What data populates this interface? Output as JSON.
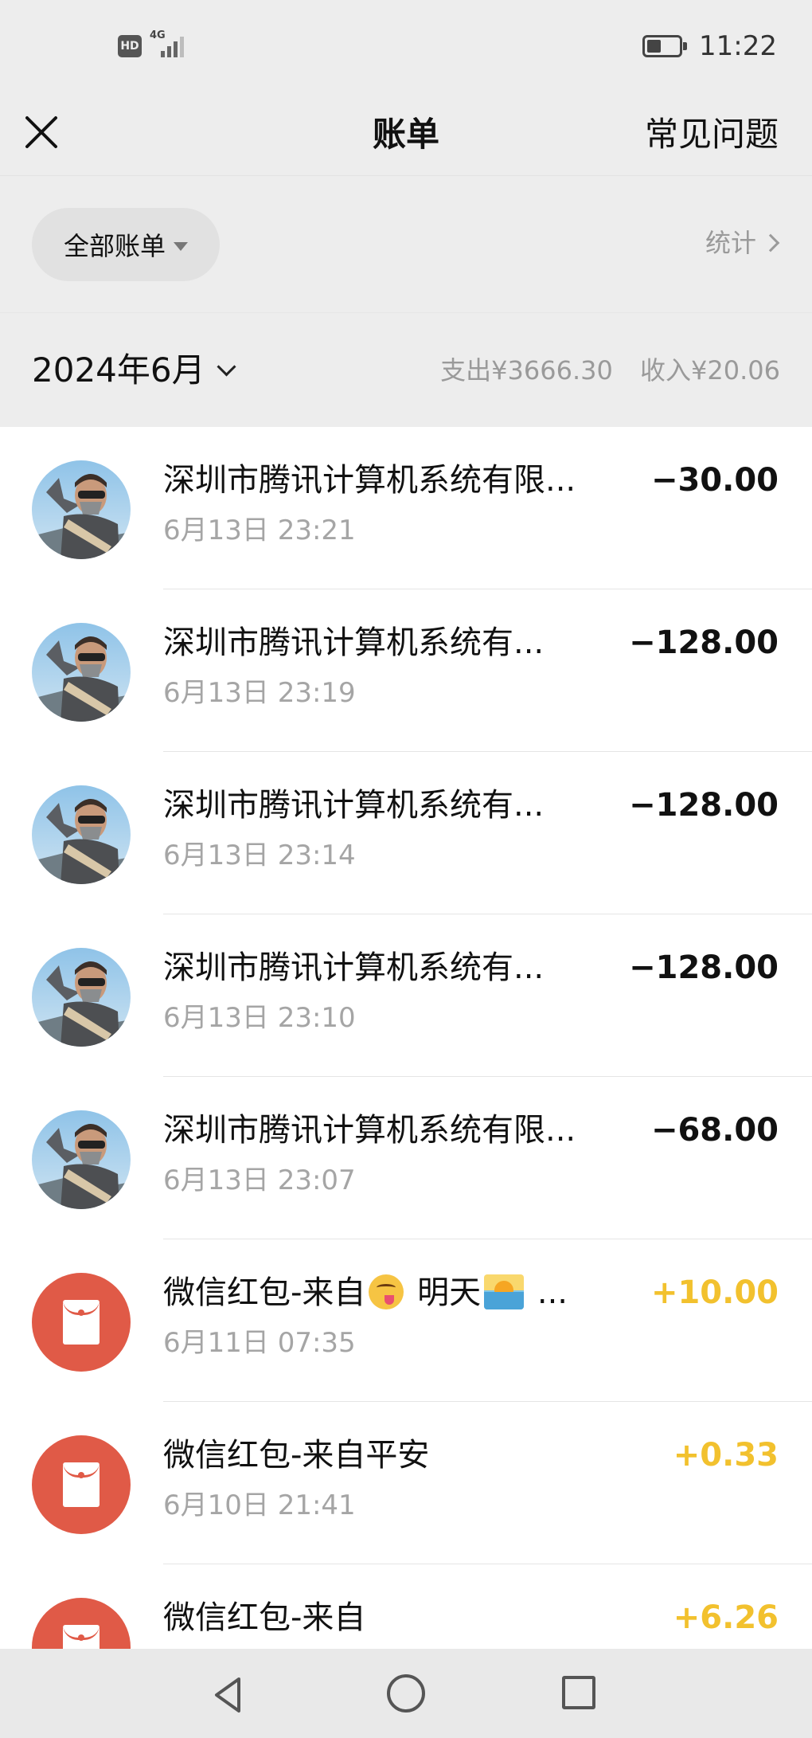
{
  "status_bar": {
    "hd": "HD",
    "network": "4G",
    "time": "11:22",
    "battery_level": 0.45
  },
  "header": {
    "title": "账单",
    "faq_label": "常见问题"
  },
  "filter": {
    "label": "全部账单",
    "stats_label": "统计"
  },
  "month": {
    "label": "2024年6月",
    "expense": "支出¥3666.30",
    "income": "收入¥20.06"
  },
  "bills": [
    {
      "title": "深圳市腾讯计算机系统有限...",
      "time": "6月13日 23:21",
      "amount": "−30.00",
      "type": "expense",
      "avatar": "user-photo"
    },
    {
      "title": "深圳市腾讯计算机系统有...",
      "time": "6月13日 23:19",
      "amount": "−128.00",
      "type": "expense",
      "avatar": "user-photo"
    },
    {
      "title": "深圳市腾讯计算机系统有...",
      "time": "6月13日 23:14",
      "amount": "−128.00",
      "type": "expense",
      "avatar": "user-photo"
    },
    {
      "title": "深圳市腾讯计算机系统有...",
      "time": "6月13日 23:10",
      "amount": "−128.00",
      "type": "expense",
      "avatar": "user-photo"
    },
    {
      "title": "深圳市腾讯计算机系统有限...",
      "time": "6月13日 23:07",
      "amount": "−68.00",
      "type": "expense",
      "avatar": "user-photo"
    },
    {
      "title_prefix": "微信红包-来自",
      "title_mid": " 明天",
      "title_suffix": " ...",
      "time": "6月11日 07:35",
      "amount": "+10.00",
      "type": "income",
      "avatar": "red-packet-icon"
    },
    {
      "title": "微信红包-来自平安",
      "time": "6月10日 21:41",
      "amount": "+0.33",
      "type": "income",
      "avatar": "red-packet-icon"
    },
    {
      "title": "微信红包-来自",
      "time": "",
      "amount": "+6.26",
      "type": "income",
      "avatar": "red-packet-icon"
    }
  ],
  "colors": {
    "background": "#ededed",
    "income": "#f2c12e",
    "red_packet": "#e05a47",
    "muted_text": "#a5a5a5"
  }
}
